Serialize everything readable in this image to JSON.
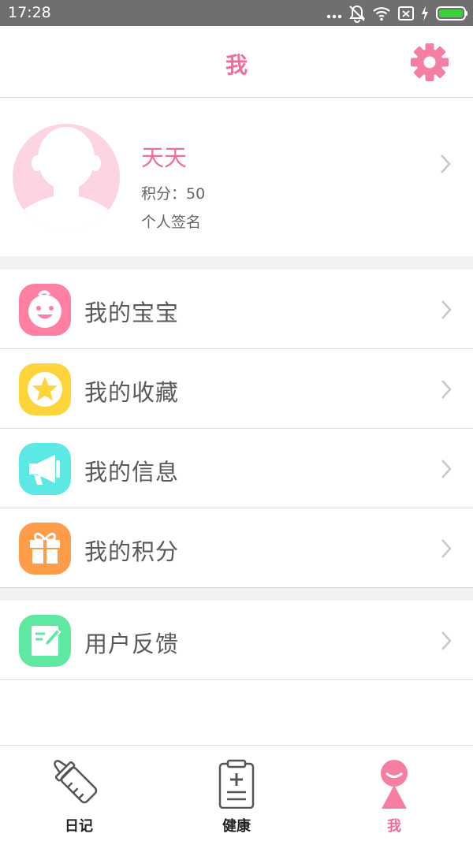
{
  "status_bar": {
    "time": "17:28",
    "icons": [
      "more-dots-icon",
      "mute-icon",
      "wifi-icon",
      "sim-icon",
      "charging-icon",
      "battery-icon"
    ]
  },
  "header": {
    "title": "我",
    "settings_icon": "gear-icon"
  },
  "profile": {
    "name": "天天",
    "points": "积分：50",
    "signature": "个人签名"
  },
  "menu": {
    "group1": [
      {
        "label": "我的宝宝",
        "icon": "baby-face-icon",
        "color": "#ff7fa3"
      },
      {
        "label": "我的收藏",
        "icon": "star-icon",
        "color": "#ffd43a"
      },
      {
        "label": "我的信息",
        "icon": "megaphone-icon",
        "color": "#5ce8e4"
      },
      {
        "label": "我的积分",
        "icon": "gift-icon",
        "color": "#ff9c4a"
      }
    ],
    "group2": [
      {
        "label": "用户反馈",
        "icon": "feedback-note-icon",
        "color": "#5ee8a2"
      }
    ]
  },
  "tabs": [
    {
      "label": "日记",
      "icon": "baby-bottle-icon",
      "active": false
    },
    {
      "label": "健康",
      "icon": "medical-clipboard-icon",
      "active": false
    },
    {
      "label": "我",
      "icon": "person-icon",
      "active": true
    }
  ],
  "colors": {
    "accent": "#f06f99",
    "status_bar": "#6f6f6f",
    "divider": "#dcdcdc",
    "section_gap": "#f2f2f2",
    "avatar_bg": "#fcd5e0"
  }
}
